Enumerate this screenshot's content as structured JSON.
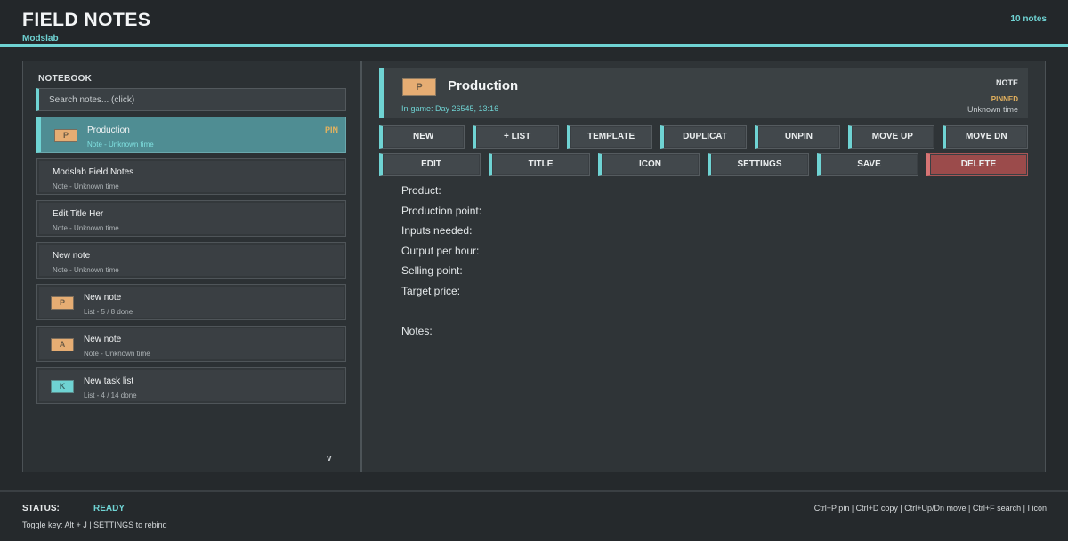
{
  "header": {
    "title": "FIELD NOTES",
    "subtitle": "Modslab",
    "count": "10 notes"
  },
  "sidebar": {
    "heading": "NOTEBOOK",
    "search_placeholder": "Search notes... (click)",
    "scroll_glyph": "v",
    "items": [
      {
        "title": "Production",
        "meta": "Note - Unknown time",
        "icon": "P",
        "icon_name": "parchment-p-icon",
        "icon_color": "#e6ad73",
        "pin": "PIN",
        "selected": true
      },
      {
        "title": "Modslab Field Notes",
        "meta": "Note - Unknown time"
      },
      {
        "title": "Edit Title Her",
        "meta": "Note - Unknown time"
      },
      {
        "title": "New note",
        "meta": "Note - Unknown time"
      },
      {
        "title": "New note",
        "meta": "List - 5 / 8 done",
        "icon": "P",
        "icon_name": "parchment-p-icon",
        "icon_color": "#e6ad73"
      },
      {
        "title": "New note",
        "meta": "Note - Unknown time",
        "icon": "A",
        "icon_name": "parchment-a-icon",
        "icon_color": "#e6ad73"
      },
      {
        "title": "New task list",
        "meta": "List - 4 / 14 done",
        "icon": "K",
        "icon_name": "teal-k-icon",
        "icon_color": "#6fd3d3"
      }
    ]
  },
  "detail": {
    "icon": "P",
    "title": "Production",
    "timestamp": "In-game: Day 26545, 13:16",
    "type": "NOTE",
    "status": "PINNED",
    "time": "Unknown time",
    "toolbar_row1": [
      "NEW",
      "+ LIST",
      "TEMPLATE",
      "DUPLICAT",
      "UNPIN",
      "MOVE UP",
      "MOVE DN"
    ],
    "toolbar_row2": [
      "EDIT",
      "TITLE",
      "ICON",
      "SETTINGS",
      "SAVE",
      "DELETE"
    ],
    "body_lines": [
      "Product:",
      "Production point:",
      "Inputs needed:",
      "Output per hour:",
      "Selling point:",
      "Target price:",
      "",
      "Notes:"
    ]
  },
  "statusbar": {
    "label": "STATUS:",
    "value": "READY",
    "toggle_hint": "Toggle key: Alt + J  |  SETTINGS to rebind",
    "shortcuts": "Ctrl+P pin | Ctrl+D copy | Ctrl+Up/Dn move | Ctrl+F search | I icon"
  },
  "colors": {
    "accent": "#6fd3d3",
    "pin": "#e6b35e",
    "danger": "#9b4b4b",
    "selected_bg": "#4f8d93"
  }
}
